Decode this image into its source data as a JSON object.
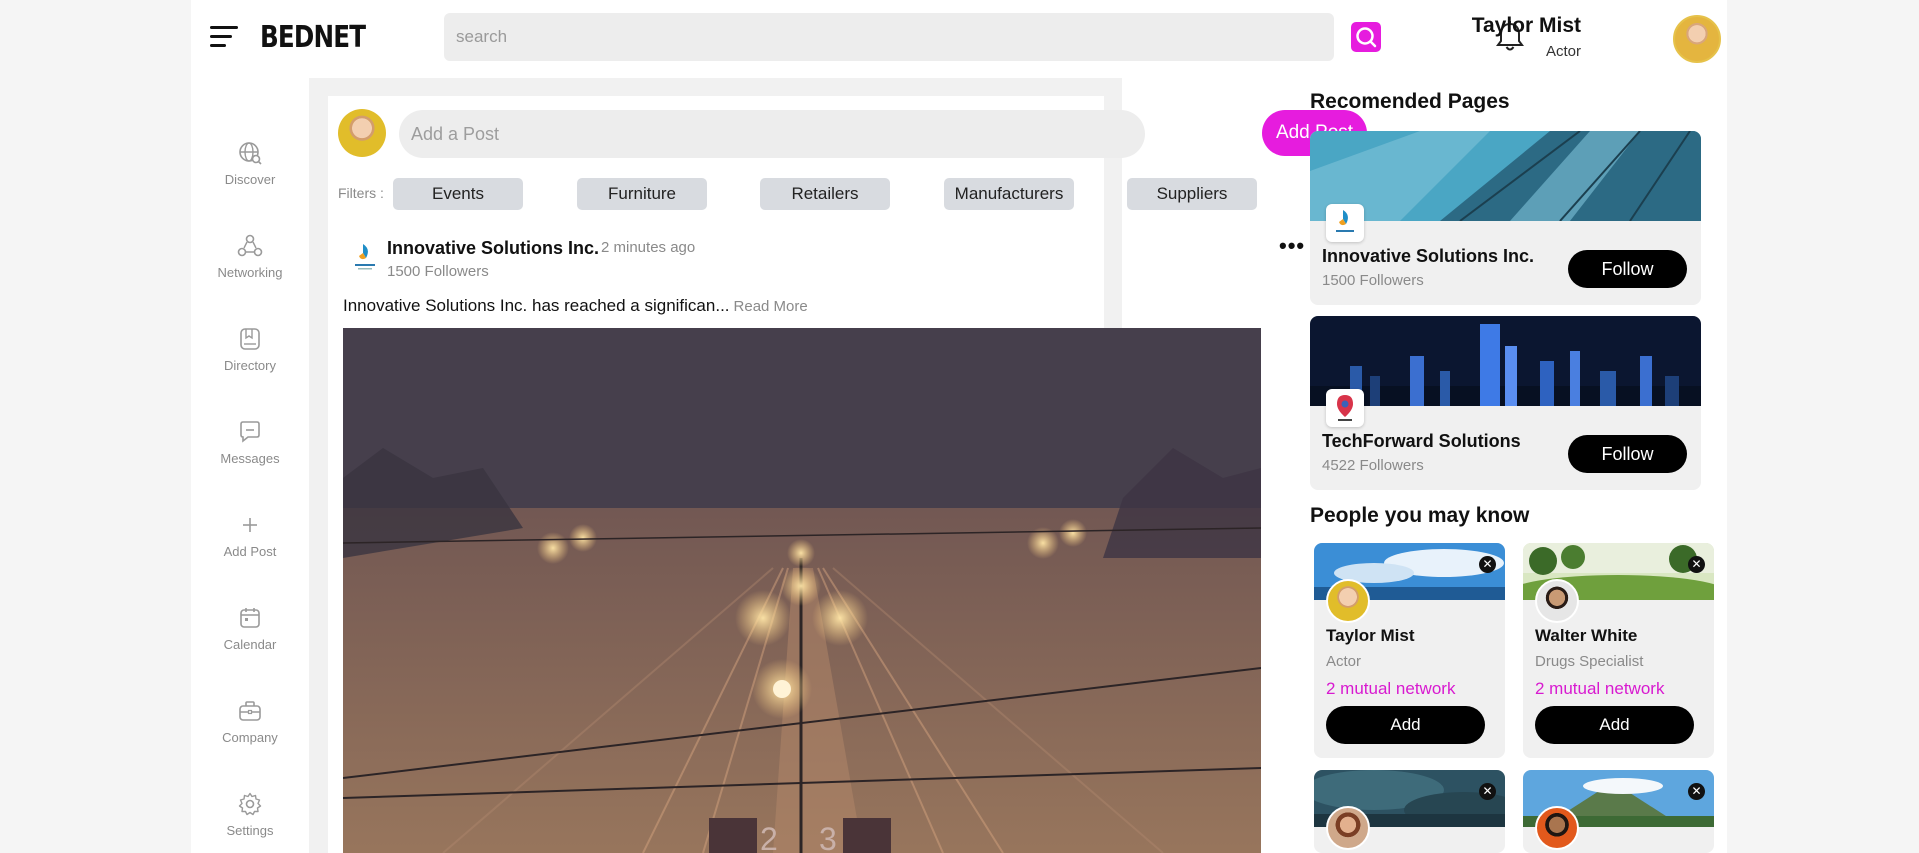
{
  "header": {
    "logo": "BEDNET",
    "search_placeholder": "search",
    "user_name": "Taylor Mist",
    "user_role": "Actor",
    "accent_color": "#e61cde"
  },
  "sidebar": {
    "items": [
      {
        "label": "Discover",
        "icon": "globe-search-icon"
      },
      {
        "label": "Networking",
        "icon": "network-icon"
      },
      {
        "label": "Directory",
        "icon": "book-icon"
      },
      {
        "label": "Messages",
        "icon": "message-icon"
      },
      {
        "label": "Add Post",
        "icon": "plus-icon"
      },
      {
        "label": "Calendar",
        "icon": "calendar-icon"
      },
      {
        "label": "Company",
        "icon": "briefcase-icon"
      },
      {
        "label": "Settings",
        "icon": "gear-icon"
      }
    ]
  },
  "composer": {
    "placeholder": "Add a Post",
    "button_label": "Add Post"
  },
  "filters": {
    "label": "Filters :",
    "items": [
      "Events",
      "Furniture",
      "Retailers",
      "Manufacturers",
      "Suppliers"
    ]
  },
  "post": {
    "company": "Innovative Solutions Inc.",
    "time": "2 minutes ago",
    "followers": "1500 Followers",
    "text": "Innovative Solutions Inc. has reached a significan...",
    "read_more": "Read More",
    "menu": "•••",
    "image_signs": [
      "2",
      "3"
    ]
  },
  "recommended": {
    "title": "Recomended Pages",
    "pages": [
      {
        "name": "Innovative Solutions Inc.",
        "followers": "1500 Followers",
        "button": "Follow"
      },
      {
        "name": "TechForward Solutions",
        "followers": "4522 Followers",
        "button": "Follow"
      }
    ]
  },
  "people": {
    "title": "People you may know",
    "cards": [
      {
        "name": "Taylor Mist",
        "role": "Actor",
        "mutual": "2 mutual network",
        "button": "Add"
      },
      {
        "name": "Walter White",
        "role": "Drugs Specialist",
        "mutual": "2 mutual network",
        "button": "Add"
      }
    ]
  }
}
